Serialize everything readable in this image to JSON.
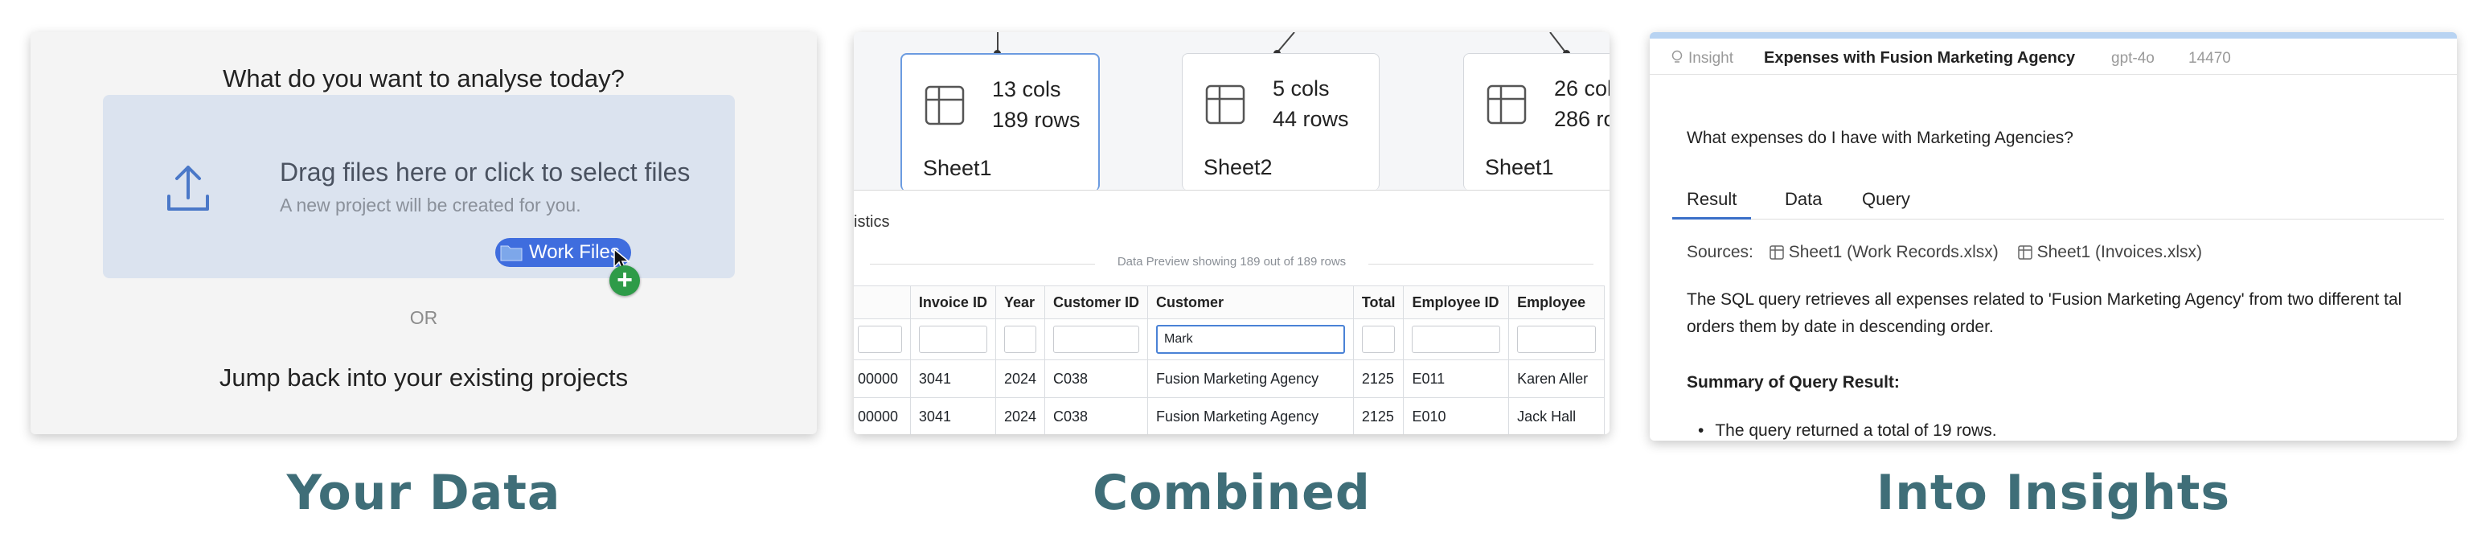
{
  "panel_your_data": {
    "question": "What do you want to analyse today?",
    "drop_title": "Drag files here or click to select files",
    "drop_subtitle": "A new project will be created for you.",
    "dragged_item": "Work Files",
    "or_label": "OR",
    "jump_back": "Jump back into your existing projects",
    "caption": "Your Data"
  },
  "panel_combined": {
    "cards": [
      {
        "cols": "13 cols",
        "rows": "189 rows",
        "name": "Sheet1"
      },
      {
        "cols": "5 cols",
        "rows": "44 rows",
        "name": "Sheet2"
      },
      {
        "cols": "26 col",
        "rows": "286 ro",
        "name": "Sheet1"
      }
    ],
    "stats_tab": "istics",
    "preview_label": "Data Preview   showing 189 out of 189 rows",
    "columns": [
      "",
      "Invoice ID",
      "Year",
      "Customer ID",
      "Customer",
      "Total",
      "Employee ID",
      "Employee"
    ],
    "filter_value": "Mark",
    "rows": [
      [
        "00000",
        "3041",
        "2024",
        "C038",
        "Fusion Marketing Agency",
        "2125",
        "E011",
        "Karen Aller"
      ],
      [
        "00000",
        "3041",
        "2024",
        "C038",
        "Fusion Marketing Agency",
        "2125",
        "E010",
        "Jack Hall"
      ]
    ],
    "caption": "Combined"
  },
  "panel_insights": {
    "insight_label": "Insight",
    "title": "Expenses with Fusion Marketing Agency",
    "model": "gpt-4o",
    "tokens": "14470",
    "question": "What expenses do I have with Marketing Agencies?",
    "tabs": [
      "Result",
      "Data",
      "Query"
    ],
    "sources_label": "Sources:",
    "sources": [
      "Sheet1 (Work Records.xlsx)",
      "Sheet1 (Invoices.xlsx)"
    ],
    "body_line1": "The SQL query retrieves all expenses related to 'Fusion Marketing Agency' from two different tal",
    "body_line2": "orders them by date in descending order.",
    "summary_heading": "Summary of Query Result:",
    "bullet1": "The query returned a total of 19 rows.",
    "caption": "Into Insights"
  },
  "colors": {
    "caption": "#3f6e78",
    "accent": "#3f6dde",
    "plus": "#2e9b48",
    "drop_zone": "#dbe3ef"
  }
}
